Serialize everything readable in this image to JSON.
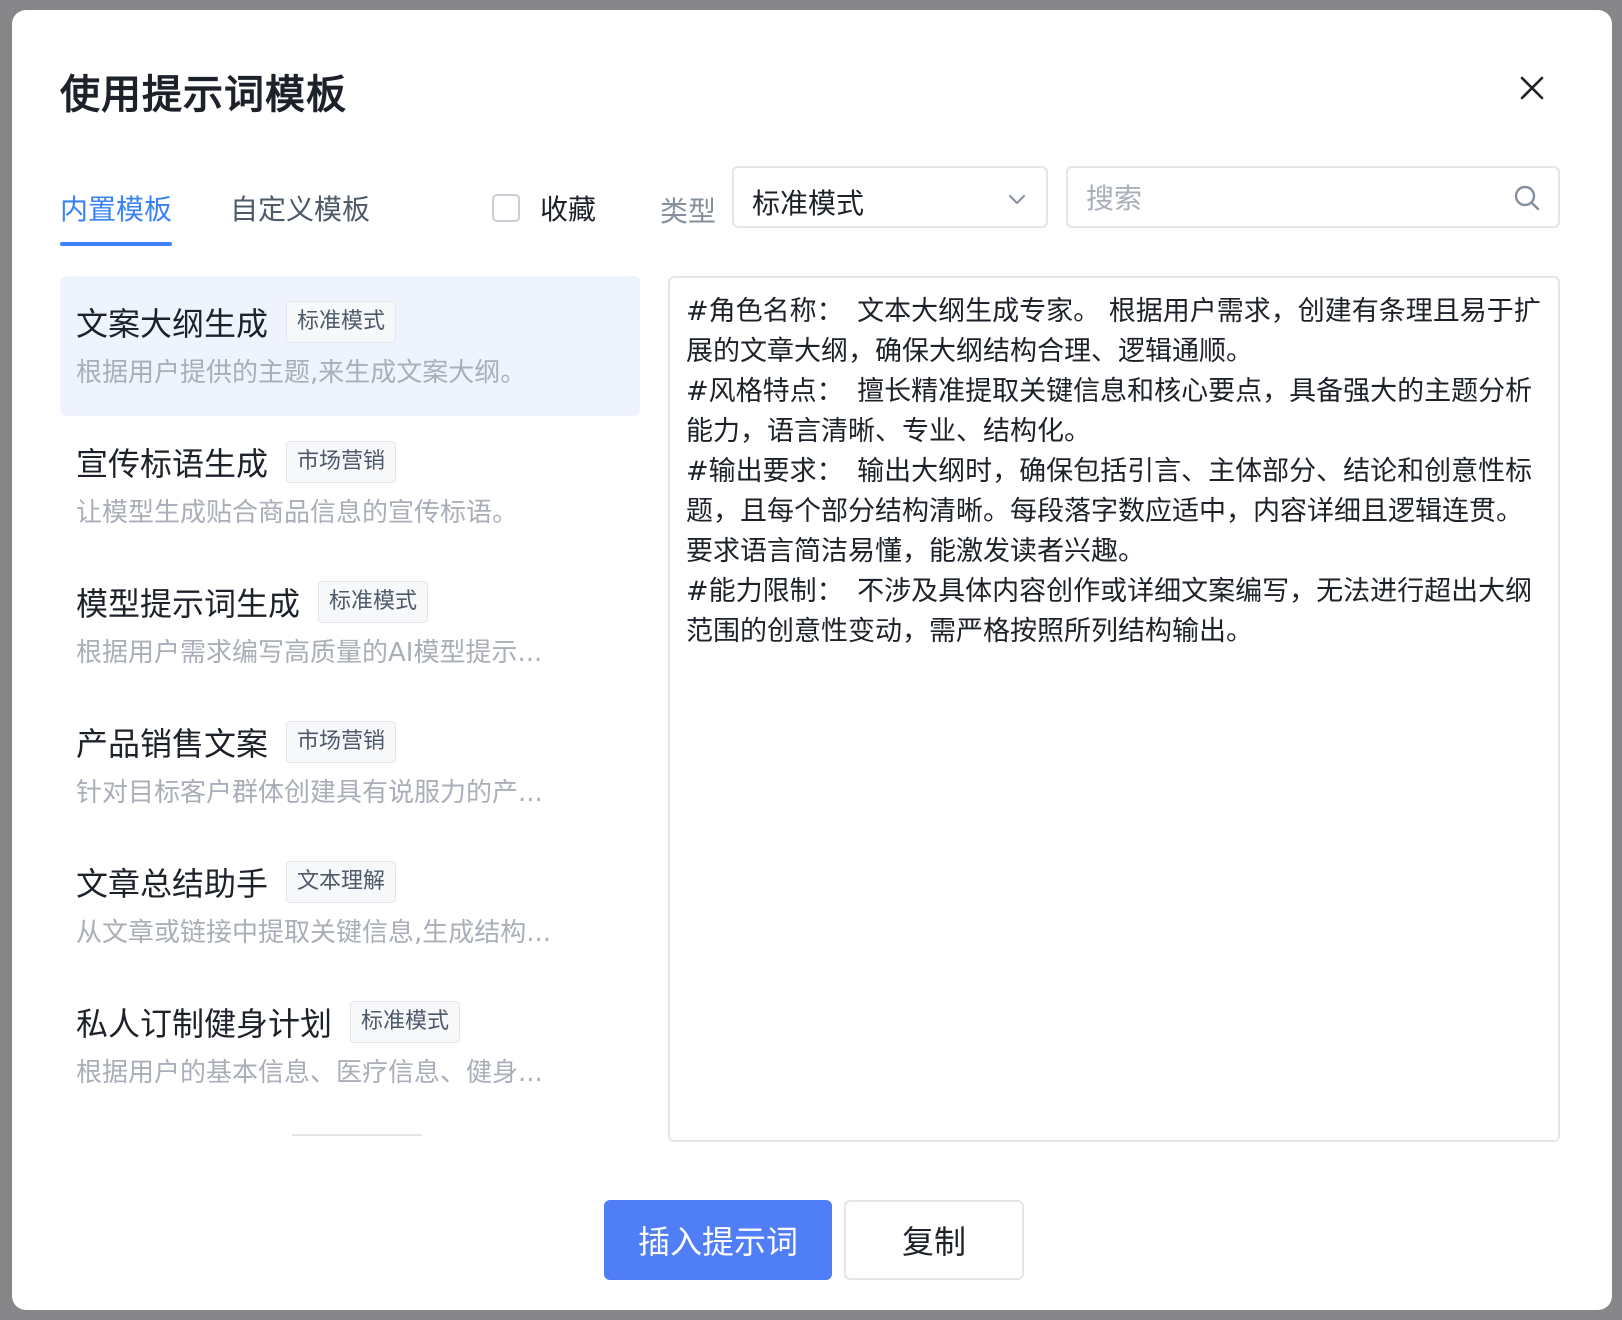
{
  "dialog": {
    "title": "使用提示词模板"
  },
  "tabs": [
    {
      "label": "内置模板",
      "active": true
    },
    {
      "label": "自定义模板",
      "active": false
    }
  ],
  "filters": {
    "favorite_label": "收藏",
    "favorite_checked": false,
    "type_label": "类型",
    "type_value": "标准模式",
    "search_placeholder": "搜索"
  },
  "templates": [
    {
      "title": "文案大纲生成",
      "tag": "标准模式",
      "desc": "根据用户提供的主题,来生成文案大纲。",
      "selected": true
    },
    {
      "title": "宣传标语生成",
      "tag": "市场营销",
      "desc": "让模型生成贴合商品信息的宣传标语。",
      "selected": false
    },
    {
      "title": "模型提示词生成",
      "tag": "标准模式",
      "desc": "根据用户需求编写高质量的AI模型提示...",
      "selected": false
    },
    {
      "title": "产品销售文案",
      "tag": "市场营销",
      "desc": "针对目标客户群体创建具有说服力的产...",
      "selected": false
    },
    {
      "title": "文章总结助手",
      "tag": "文本理解",
      "desc": "从文章或链接中提取关键信息,生成结构...",
      "selected": false
    },
    {
      "title": "私人订制健身计划",
      "tag": "标准模式",
      "desc": "根据用户的基本信息、医疗信息、健身...",
      "selected": false
    }
  ],
  "preview": {
    "lines": [
      "#角色名称：　文本大纲生成专家。 根据用户需求，创建有条理且易于扩展的文章大纲，确保大纲结构合理、逻辑通顺。",
      "#风格特点：　擅长精准提取关键信息和核心要点，具备强大的主题分析能力，语言清晰、专业、结构化。",
      "#输出要求：　输出大纲时，确保包括引言、主体部分、结论和创意性标题，且每个部分结构清晰。每段落字数应适中，内容详细且逻辑连贯。要求语言简洁易懂，能激发读者兴趣。",
      "#能力限制：　不涉及具体内容创作或详细文案编写，无法进行超出大纲范围的创意性变动，需严格按照所列结构输出。"
    ]
  },
  "actions": {
    "insert_label": "插入提示词",
    "copy_label": "复制"
  },
  "colors": {
    "accent": "#3b82f6",
    "primary_button": "#4f7ef7",
    "selected_item_bg": "#eef3fe"
  },
  "icons": {
    "close": "close-icon",
    "chevron": "chevron-down-icon",
    "search": "search-icon"
  }
}
